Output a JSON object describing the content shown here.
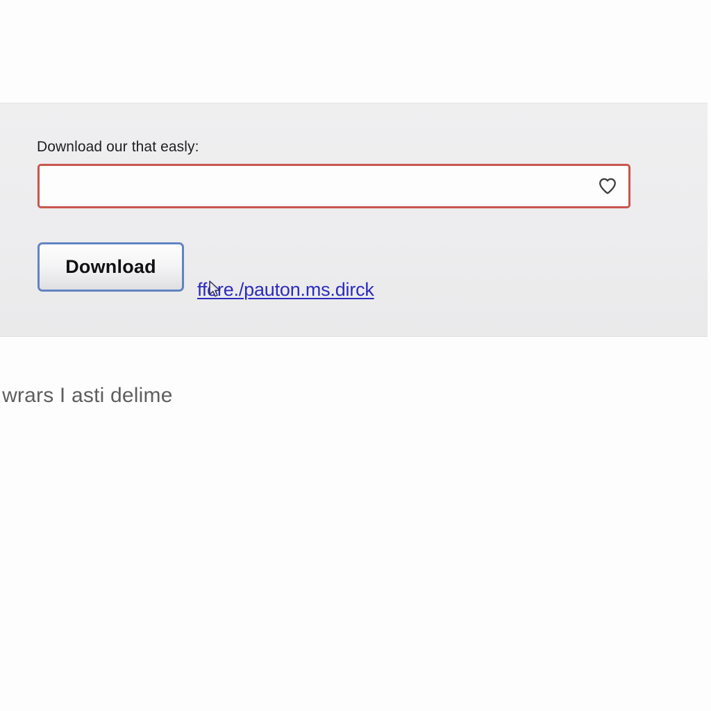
{
  "page": {
    "background_color": "#fdfdfd"
  },
  "download_panel": {
    "background_color": "#eeeeef",
    "field": {
      "label": "Download our that easly:",
      "input_value": "",
      "input_placeholder": "",
      "border_color": "#c8564f",
      "icon": "heart-icon"
    },
    "button": {
      "label": "Download",
      "border_color": "#6183c2"
    },
    "link": {
      "text": "ffore./pauton.ms.dirck",
      "color": "#2b2bbf"
    }
  },
  "bottom": {
    "text": "t wrars I asti delime",
    "color": "#5e5e60"
  }
}
